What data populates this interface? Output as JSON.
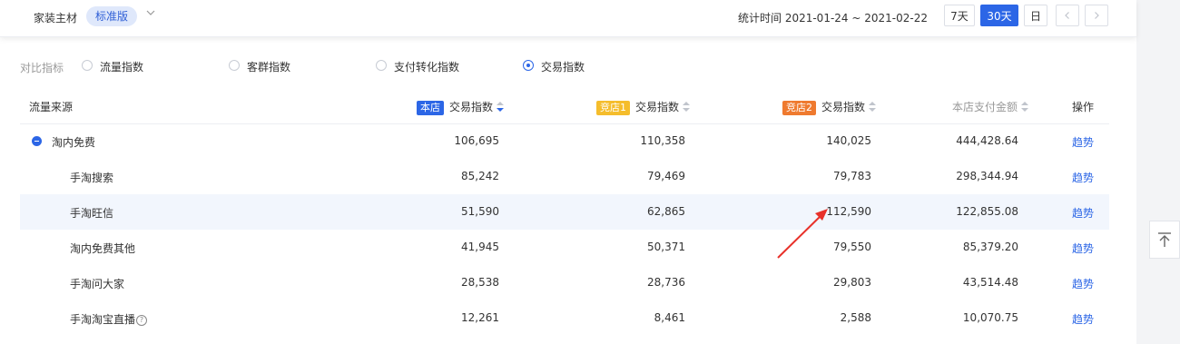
{
  "header": {
    "category": "家装主材",
    "edition": "标准版",
    "stat_time": "统计时间 2021-01-24 ~ 2021-02-22",
    "periods": [
      "7天",
      "30天",
      "日"
    ],
    "active_period": "30天"
  },
  "compare": {
    "title": "对比指标",
    "options": [
      "流量指数",
      "客群指数",
      "支付转化指数",
      "交易指数"
    ],
    "selected": "交易指数"
  },
  "table": {
    "headers": {
      "source": "流量来源",
      "own_tag": "本店",
      "own_metric": "交易指数",
      "c1_tag": "竞店1",
      "c1_metric": "交易指数",
      "c2_tag": "竞店2",
      "c2_metric": "交易指数",
      "amount": "本店支付金额",
      "action": "操作"
    },
    "rows": [
      {
        "source": "淘内免费",
        "own": "106,695",
        "c1": "110,358",
        "c2": "140,025",
        "amount": "444,428.64",
        "action": "趋势"
      },
      {
        "source": "手淘搜索",
        "own": "85,242",
        "c1": "79,469",
        "c2": "79,783",
        "amount": "298,344.94",
        "action": "趋势"
      },
      {
        "source": "手淘旺信",
        "own": "51,590",
        "c1": "62,865",
        "c2": "112,590",
        "amount": "122,855.08",
        "action": "趋势"
      },
      {
        "source": "淘内免费其他",
        "own": "41,945",
        "c1": "50,371",
        "c2": "79,550",
        "amount": "85,379.20",
        "action": "趋势"
      },
      {
        "source": "手淘问大家",
        "own": "28,538",
        "c1": "28,736",
        "c2": "29,803",
        "amount": "43,514.48",
        "action": "趋势"
      },
      {
        "source": "手淘淘宝直播",
        "own": "12,261",
        "c1": "8,461",
        "c2": "2,588",
        "amount": "10,070.75",
        "action": "趋势"
      }
    ]
  },
  "colors": {
    "accent": "#2c66e6",
    "annotation_arrow": "#e8312a"
  }
}
